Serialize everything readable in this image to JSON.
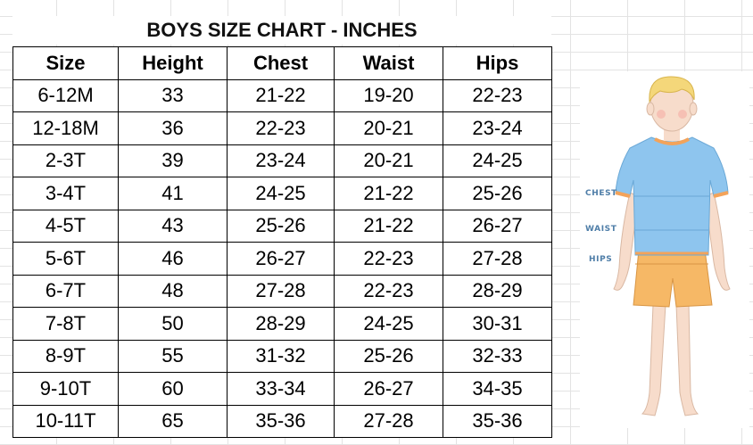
{
  "title": "BOYS SIZE CHART - INCHES",
  "columns": [
    "Size",
    "Height",
    "Chest",
    "Waist",
    "Hips"
  ],
  "rows": [
    [
      "6-12M",
      "33",
      "21-22",
      "19-20",
      "22-23"
    ],
    [
      "12-18M",
      "36",
      "22-23",
      "20-21",
      "23-24"
    ],
    [
      "2-3T",
      "39",
      "23-24",
      "20-21",
      "24-25"
    ],
    [
      "3-4T",
      "41",
      "24-25",
      "21-22",
      "25-26"
    ],
    [
      "4-5T",
      "43",
      "25-26",
      "21-22",
      "26-27"
    ],
    [
      "5-6T",
      "46",
      "26-27",
      "22-23",
      "27-28"
    ],
    [
      "6-7T",
      "48",
      "27-28",
      "22-23",
      "28-29"
    ],
    [
      "7-8T",
      "50",
      "28-29",
      "24-25",
      "30-31"
    ],
    [
      "8-9T",
      "55",
      "31-32",
      "25-26",
      "32-33"
    ],
    [
      "9-10T",
      "60",
      "33-34",
      "26-27",
      "34-35"
    ],
    [
      "10-11T",
      "65",
      "35-36",
      "27-28",
      "35-36"
    ]
  ],
  "figure": {
    "chest_label": "CHEST",
    "waist_label": "WAIST",
    "hips_label": "HIPS",
    "colors": {
      "shirt": "#8ec5ee",
      "shorts": "#f6b866",
      "trim": "#f3a35a",
      "skin": "#f7dccb",
      "hair": "#f4d77a",
      "label": "#4f7ea8"
    }
  }
}
